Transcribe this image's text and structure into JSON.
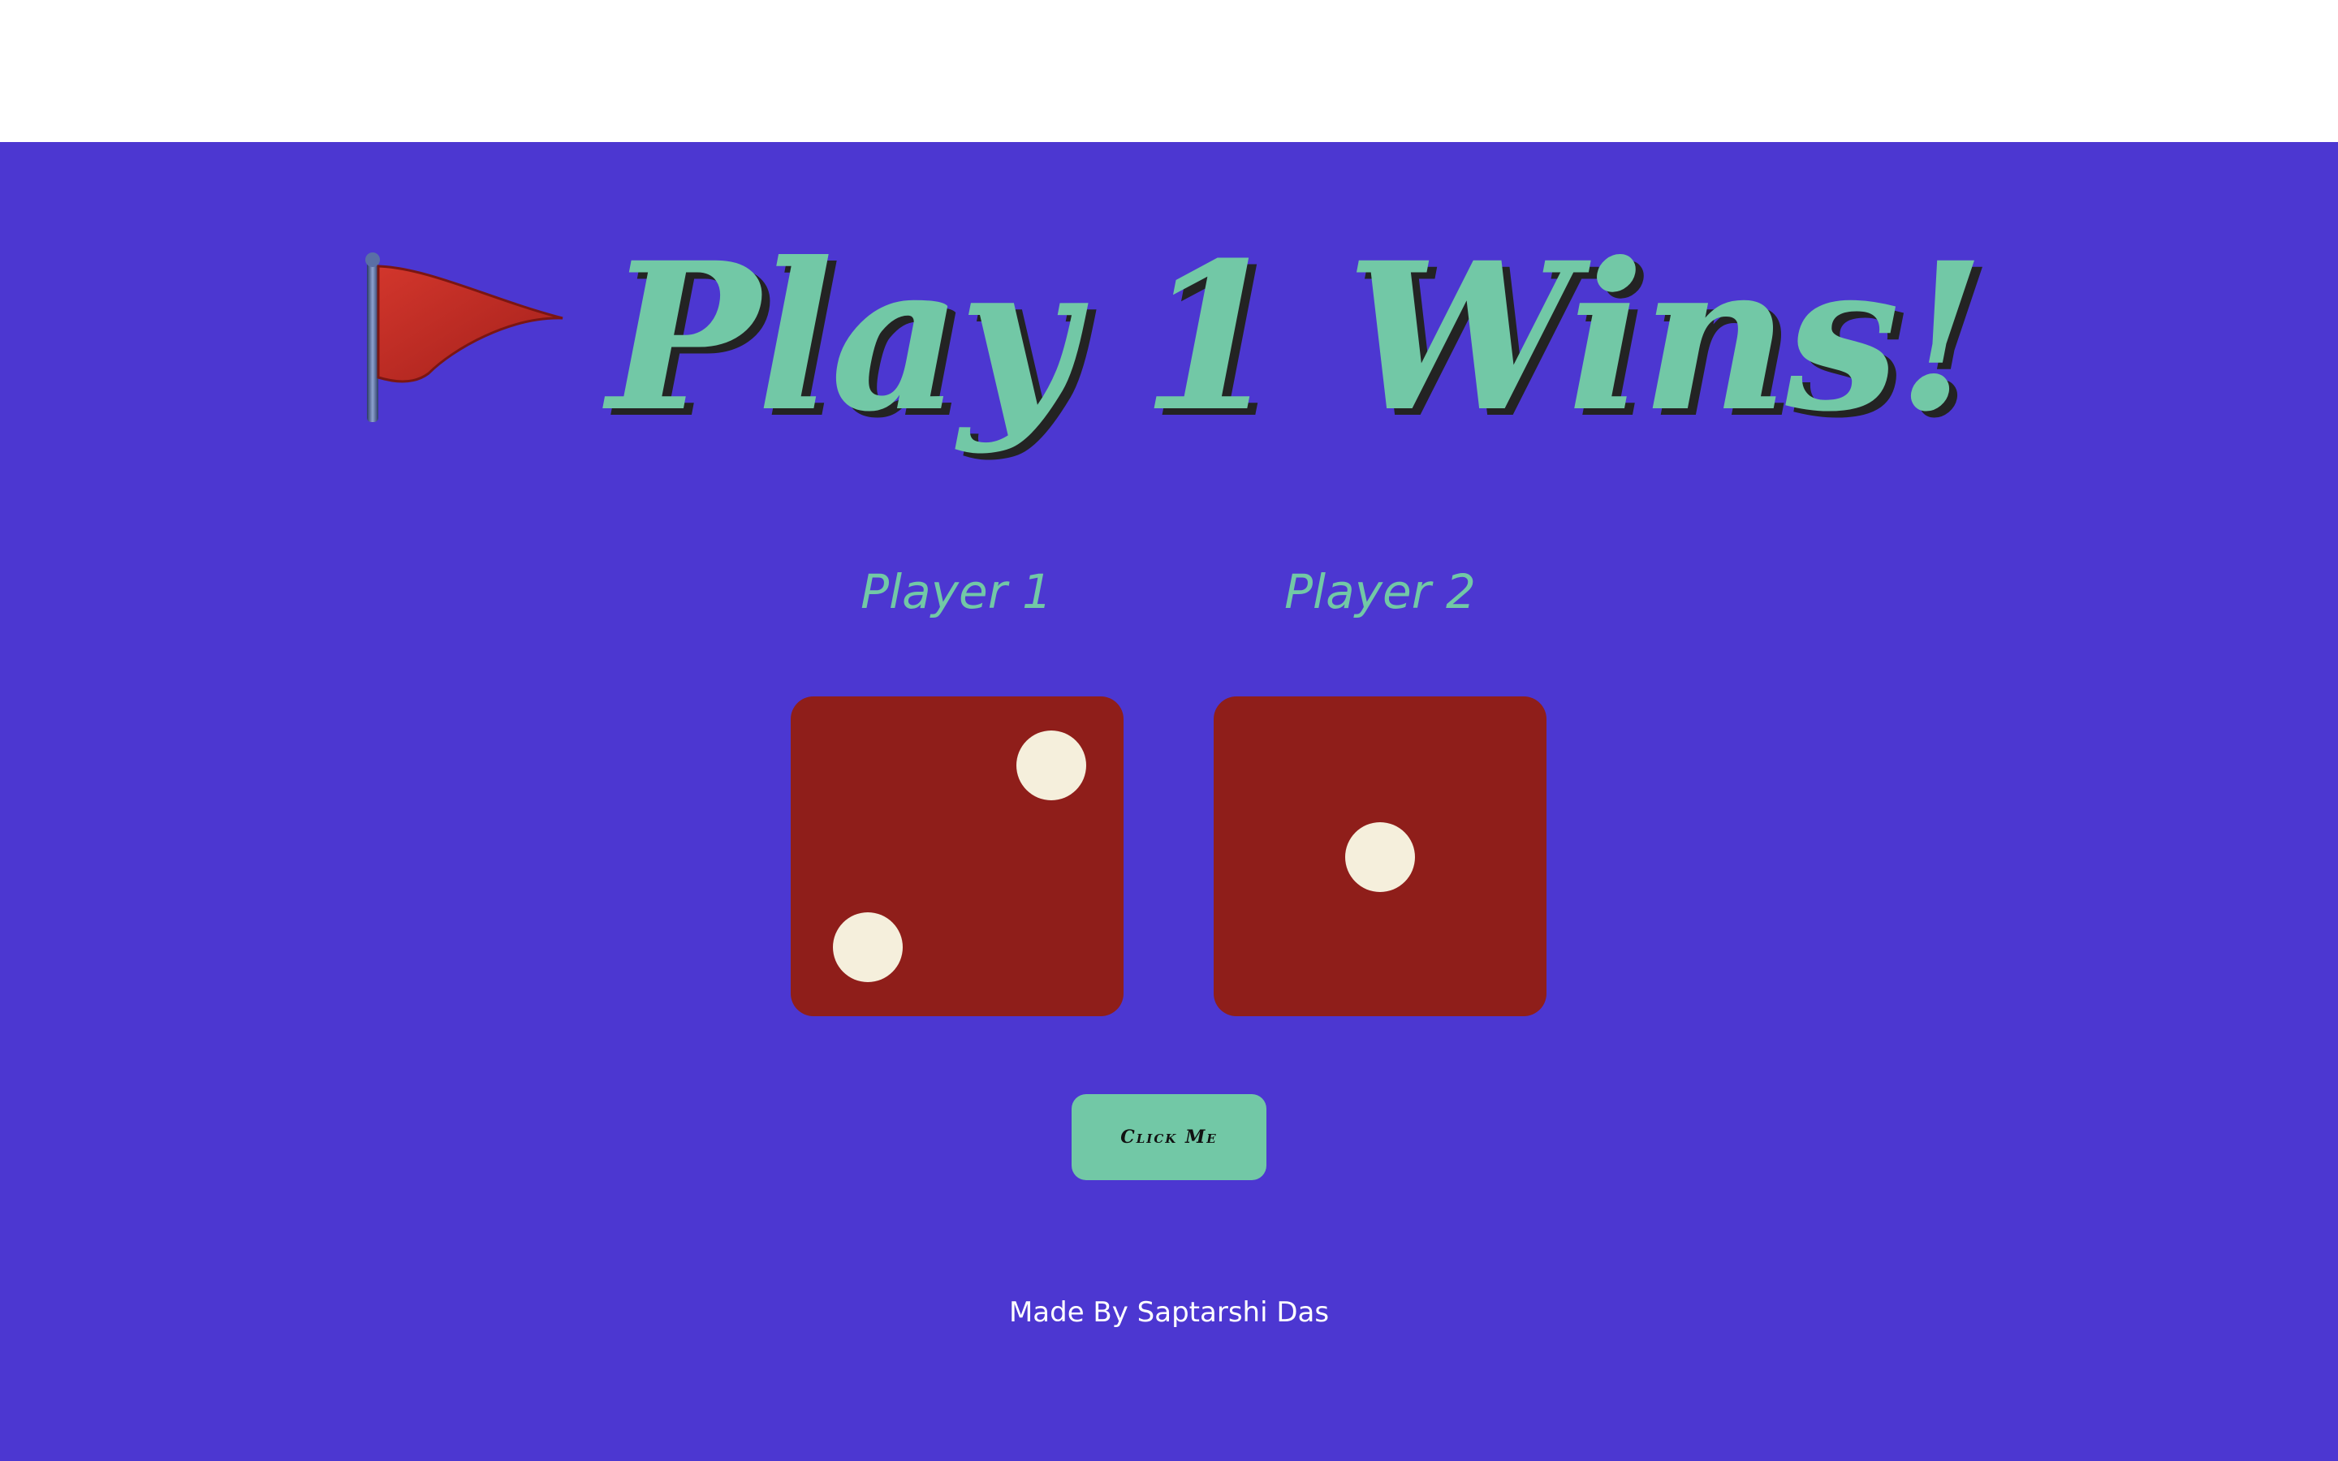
{
  "header": {
    "title": "Play 1 Wins!",
    "flag_icon": "red-flag-icon"
  },
  "players": [
    {
      "label": "Player 1",
      "die_value": 2
    },
    {
      "label": "Player 2",
      "die_value": 1
    }
  ],
  "button": {
    "label": "Click Me"
  },
  "footer": {
    "text": "Made By Saptarshi Das"
  },
  "colors": {
    "background": "#4c37d1",
    "accent": "#72c8a6",
    "die": "#8f1e1a",
    "pip": "#f5efdc"
  }
}
